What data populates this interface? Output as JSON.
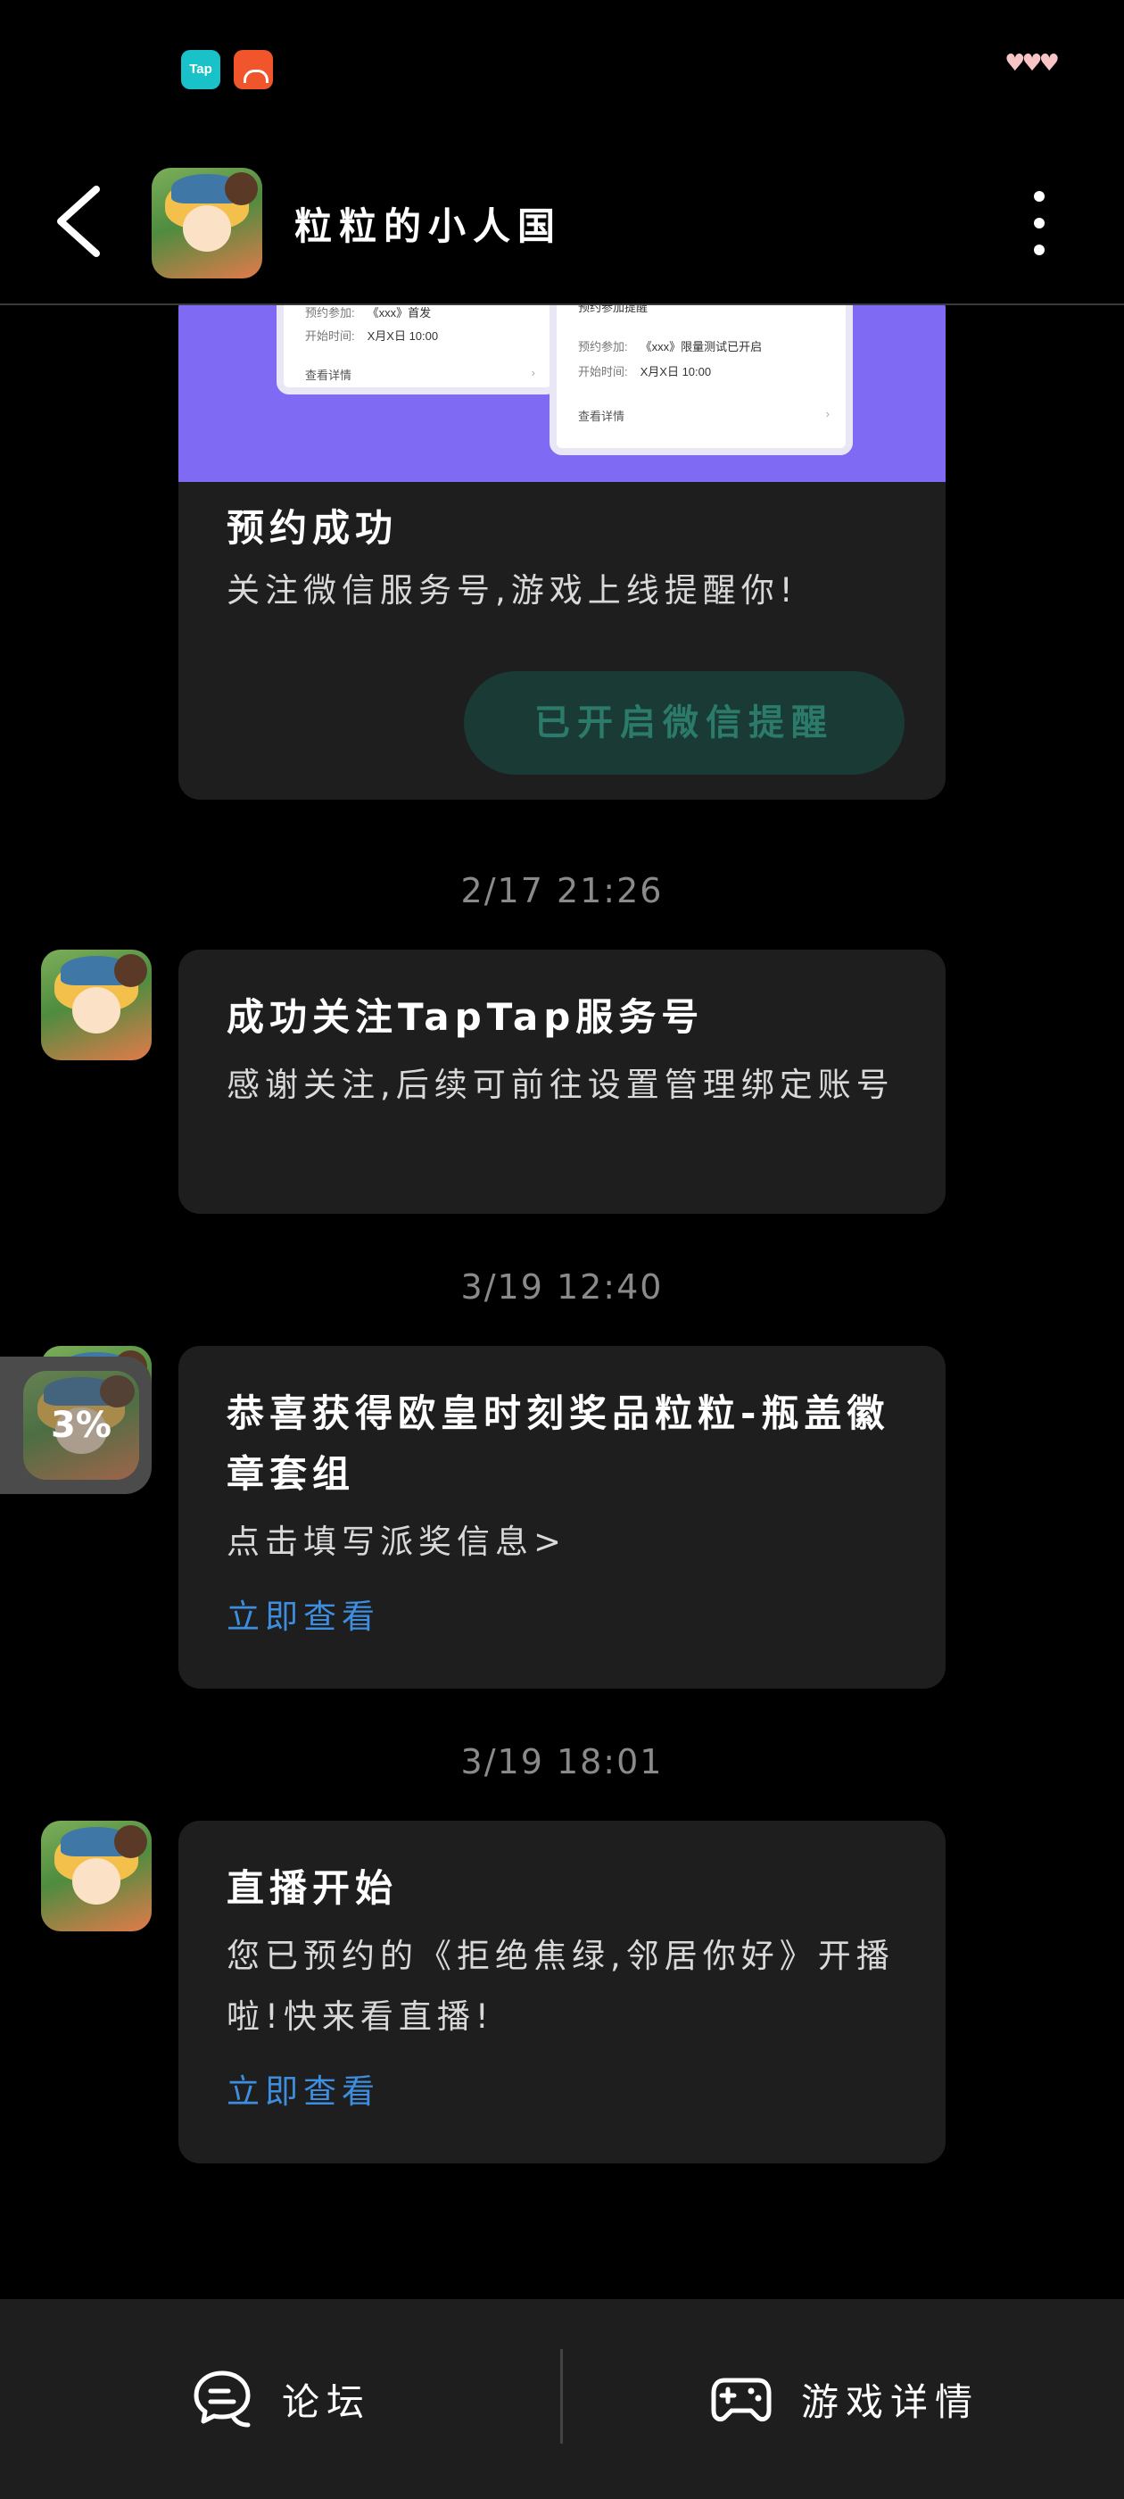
{
  "status_bar": {
    "tap_icon_label": "Tap",
    "hearts": "♥♥♥"
  },
  "header": {
    "title": "粒粒的小人国"
  },
  "reservation_card": {
    "mock_a": {
      "row1_label": "预约参加:",
      "row1_value": "《xxx》首发",
      "row2_label": "开始时间:",
      "row2_value": "X月X日 10:00",
      "more": "查看详情"
    },
    "mock_b": {
      "title": "预约参加提醒",
      "row1_label": "预约参加:",
      "row1_value": "《xxx》限量测试已开启",
      "row2_label": "开始时间:",
      "row2_value": "X月X日 10:00",
      "more": "查看详情"
    },
    "title": "预约成功",
    "desc": "关注微信服务号,游戏上线提醒你!",
    "button_label": "已开启微信提醒"
  },
  "messages": [
    {
      "time": "2/17 21:26",
      "title": "成功关注TapTap服务号",
      "desc": "感谢关注,后续可前往设置管理绑定账号"
    },
    {
      "time": "3/19 12:40",
      "title": "恭喜获得欧皇时刻奖品粒粒-瓶盖徽章套组",
      "desc": "点击填写派奖信息>",
      "link": "立即查看"
    },
    {
      "time": "3/19 18:01",
      "title": "直播开始",
      "desc": "您已预约的《拒绝焦绿,邻居你好》开播啦!快来看直播!",
      "link": "立即查看"
    }
  ],
  "float_progress": {
    "label": "3%",
    "value": 0.03
  },
  "bottom_bar": {
    "forum_label": "论坛",
    "game_detail_label": "游戏详情"
  },
  "colors": {
    "background": "#000000",
    "card": "#1e1e1f",
    "banner": "#7f6af4",
    "link": "#3e8ee0",
    "wechat_button_bg": "#193a35",
    "wechat_button_text": "#2c7a6a"
  }
}
